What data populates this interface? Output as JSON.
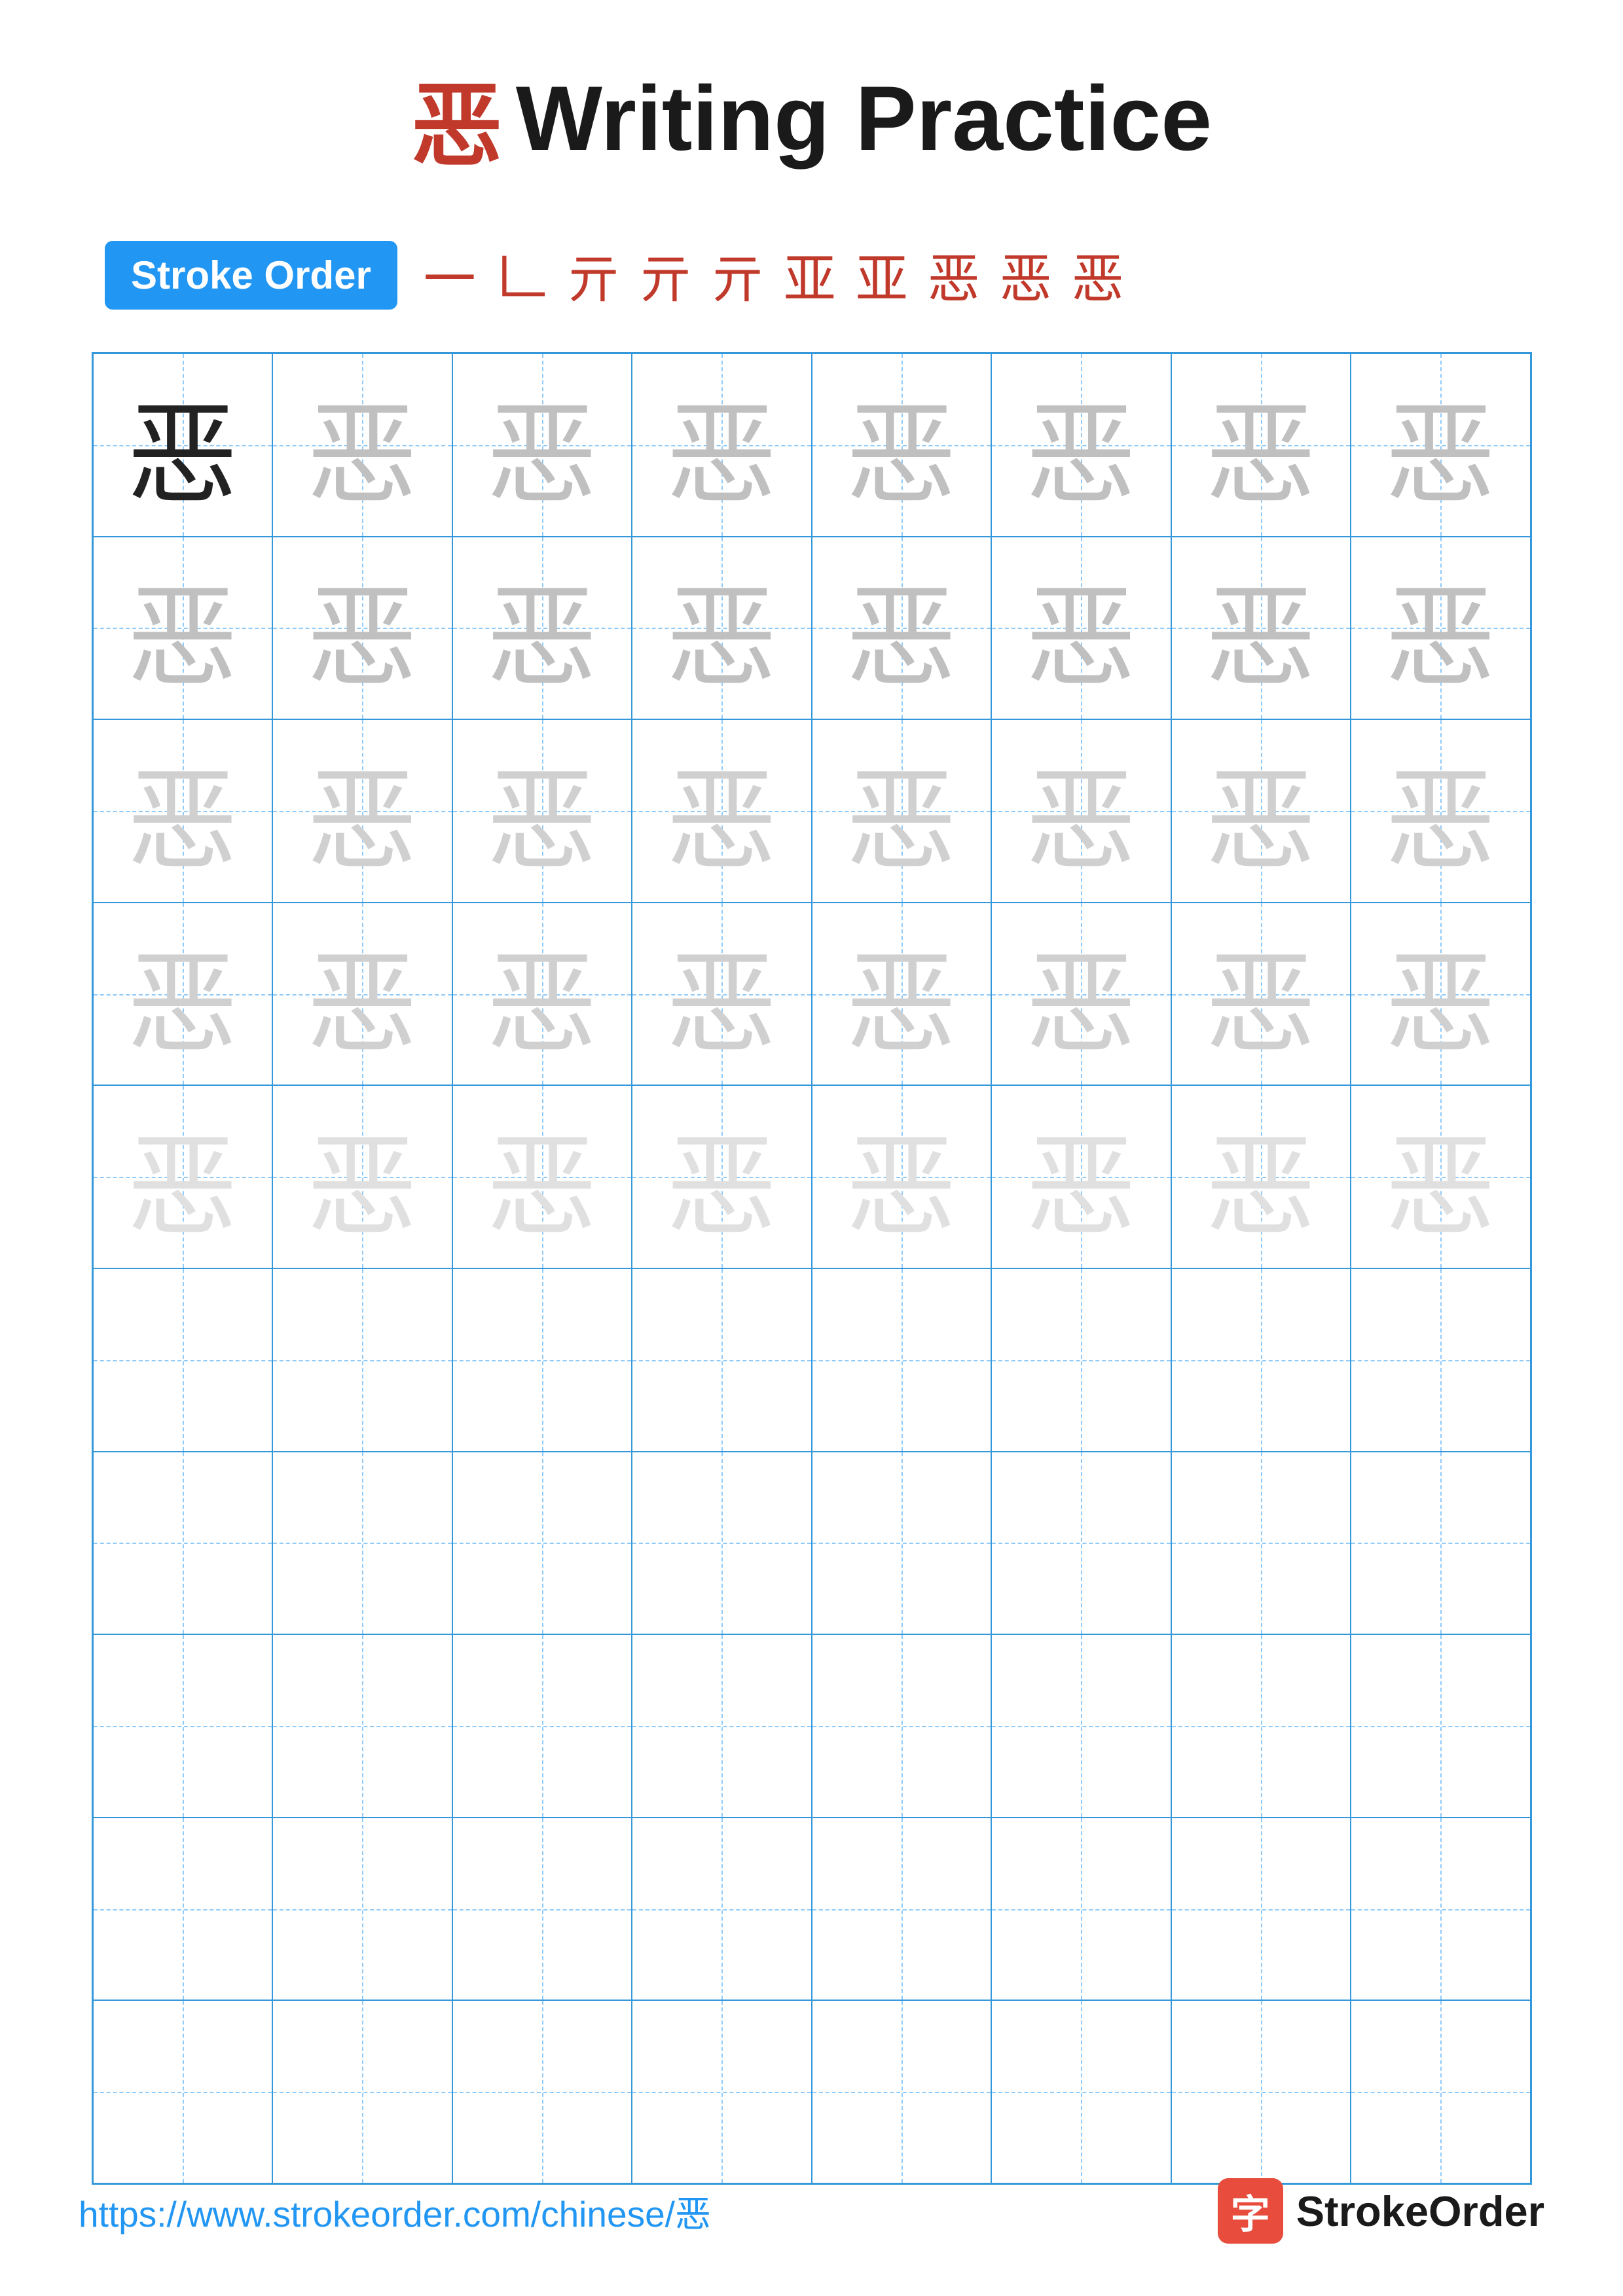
{
  "title": {
    "char": "恶",
    "text": "Writing Practice"
  },
  "stroke_order": {
    "badge_label": "Stroke Order",
    "strokes": [
      "一",
      "𠃊",
      "亓",
      "亓",
      "亓",
      "亚",
      "亚",
      "恶",
      "恶",
      "恶"
    ]
  },
  "grid": {
    "rows": 10,
    "cols": 8,
    "character": "恶",
    "opacity_pattern": [
      [
        "solid",
        "light1",
        "light1",
        "light1",
        "light1",
        "light1",
        "light1",
        "light1"
      ],
      [
        "light1",
        "light1",
        "light1",
        "light1",
        "light1",
        "light1",
        "light1",
        "light1"
      ],
      [
        "light2",
        "light2",
        "light2",
        "light2",
        "light2",
        "light2",
        "light2",
        "light2"
      ],
      [
        "light2",
        "light2",
        "light2",
        "light2",
        "light2",
        "light2",
        "light2",
        "light2"
      ],
      [
        "light3",
        "light3",
        "light3",
        "light3",
        "light3",
        "light3",
        "light3",
        "light3"
      ],
      [
        "empty",
        "empty",
        "empty",
        "empty",
        "empty",
        "empty",
        "empty",
        "empty"
      ],
      [
        "empty",
        "empty",
        "empty",
        "empty",
        "empty",
        "empty",
        "empty",
        "empty"
      ],
      [
        "empty",
        "empty",
        "empty",
        "empty",
        "empty",
        "empty",
        "empty",
        "empty"
      ],
      [
        "empty",
        "empty",
        "empty",
        "empty",
        "empty",
        "empty",
        "empty",
        "empty"
      ],
      [
        "empty",
        "empty",
        "empty",
        "empty",
        "empty",
        "empty",
        "empty",
        "empty"
      ]
    ]
  },
  "footer": {
    "url": "https://www.strokeorder.com/chinese/恶",
    "logo_char": "字",
    "logo_text": "StrokeOrder"
  }
}
